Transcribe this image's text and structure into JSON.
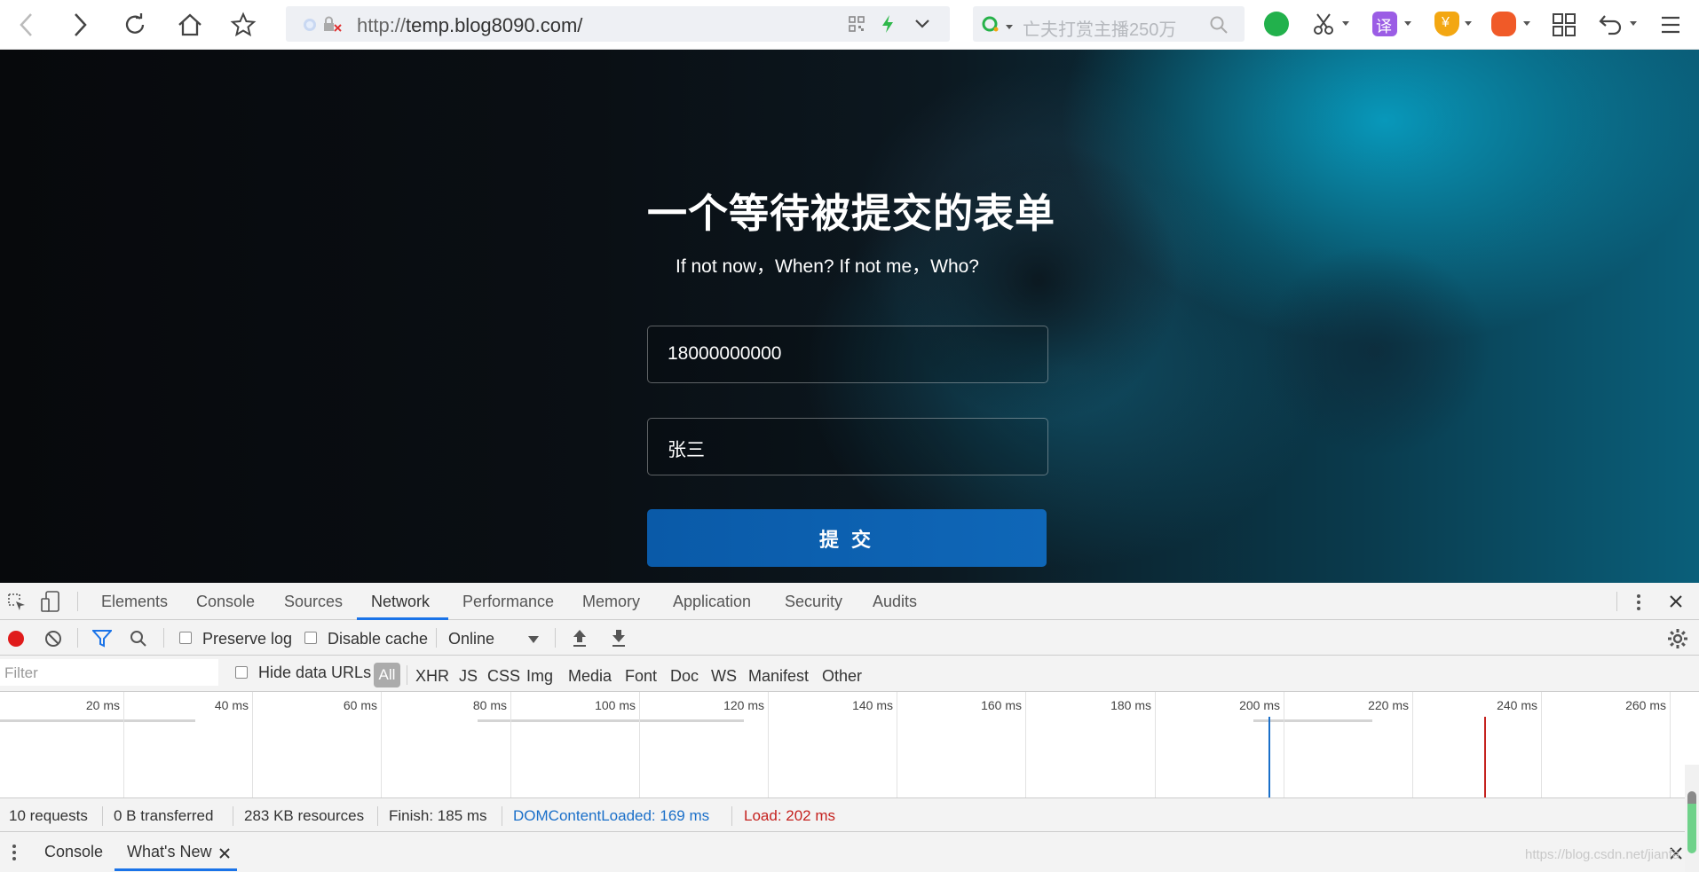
{
  "browser": {
    "url_protocol": "http://",
    "url_host": "temp.blog8090.com/",
    "search_placeholder": "亡夫打赏主播250万"
  },
  "page": {
    "title": "一个等待被提交的表单",
    "subtitle": "If not now，When? If not me，Who?",
    "phone_value": "18000000000",
    "name_value": "张三",
    "submit_label": "提 交"
  },
  "devtools": {
    "tabs": [
      "Elements",
      "Console",
      "Sources",
      "Network",
      "Performance",
      "Memory",
      "Application",
      "Security",
      "Audits"
    ],
    "active_tab": "Network",
    "preserve_log": "Preserve log",
    "disable_cache": "Disable cache",
    "throttle": "Online",
    "filter_placeholder": "Filter",
    "hide_data_urls": "Hide data URLs",
    "types": [
      "All",
      "XHR",
      "JS",
      "CSS",
      "Img",
      "Media",
      "Font",
      "Doc",
      "WS",
      "Manifest",
      "Other"
    ],
    "ticks": [
      "20 ms",
      "40 ms",
      "60 ms",
      "80 ms",
      "100 ms",
      "120 ms",
      "140 ms",
      "160 ms",
      "180 ms",
      "200 ms",
      "220 ms",
      "240 ms",
      "260 ms"
    ],
    "status": {
      "requests": "10 requests",
      "transferred": "0 B transferred",
      "resources": "283 KB resources",
      "finish": "Finish: 185 ms",
      "dom_loaded": "DOMContentLoaded: 169 ms",
      "load": "Load: 202 ms"
    },
    "drawer_tabs": [
      "Console",
      "What's New"
    ],
    "colors": {
      "accent": "#1a73e8",
      "dom_loaded": "#1a6fc9",
      "load": "#c5221f",
      "record": "#e01b1b"
    }
  },
  "watermark": "https://blog.csdn.net/jianfa"
}
